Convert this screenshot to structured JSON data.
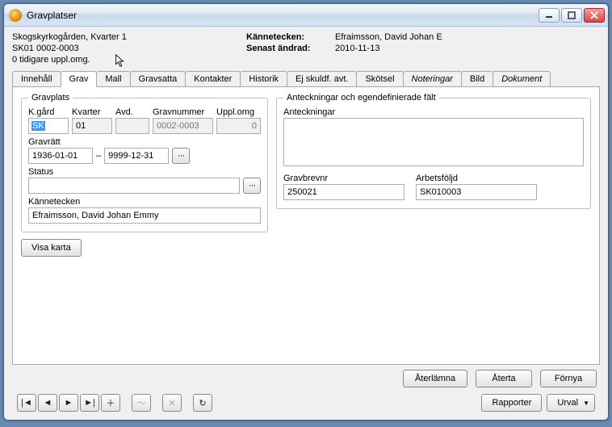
{
  "window": {
    "title": "Gravplatser"
  },
  "header": {
    "line1": "Skogskyrkogården, Kvarter 1",
    "line2": "SK01 0002-0003",
    "line3": "0 tidigare uppl.omg.",
    "kannetecken_label": "Kännetecken:",
    "kannetecken_value": "Efraimsson, David Johan E",
    "senast_label": "Senast ändrad:",
    "senast_value": "2010-11-13"
  },
  "tabs": [
    {
      "label": "Innehåll",
      "active": false
    },
    {
      "label": "Grav",
      "active": true
    },
    {
      "label": "Mall",
      "active": false
    },
    {
      "label": "Gravsatta",
      "active": false
    },
    {
      "label": "Kontakter",
      "active": false
    },
    {
      "label": "Historik",
      "active": false
    },
    {
      "label": "Ej skuldf. avt.",
      "active": false
    },
    {
      "label": "Skötsel",
      "active": false
    },
    {
      "label": "Noteringar",
      "active": false,
      "italic": true
    },
    {
      "label": "Bild",
      "active": false
    },
    {
      "label": "Dokument",
      "active": false,
      "italic": true
    }
  ],
  "gravplats": {
    "legend": "Gravplats",
    "kgard_label": "K.gård",
    "kgard_value": "SK",
    "kvarter_label": "Kvarter",
    "kvarter_value": "01",
    "avd_label": "Avd.",
    "avd_value": "",
    "gravnr_label": "Gravnummer",
    "gravnr_value": "0002-0003",
    "upplomg_label": "Uppl.omg",
    "upplomg_value": "0",
    "gravratt_label": "Gravrätt",
    "gravratt_from": "1936-01-01",
    "gravratt_sep": "–",
    "gravratt_to": "9999-12-31",
    "status_label": "Status",
    "status_value": "",
    "kannetecken_label": "Kännetecken",
    "kannetecken_value": "Efraimsson, David Johan Emmy",
    "visa_karta": "Visa karta"
  },
  "anteckningar": {
    "legend": "Anteckningar och egendefinierade fält",
    "ant_label": "Anteckningar",
    "ant_value": "",
    "gravbrevnr_label": "Gravbrevnr",
    "gravbrevnr_value": "250021",
    "arbetsfoljd_label": "Arbetsföljd",
    "arbetsfoljd_value": "SK010003"
  },
  "actions": {
    "aterlamna": "Återlämna",
    "aterta": "Återta",
    "fornya": "Förnya"
  },
  "footer": {
    "rapporter": "Rapporter",
    "urval": "Urval"
  }
}
